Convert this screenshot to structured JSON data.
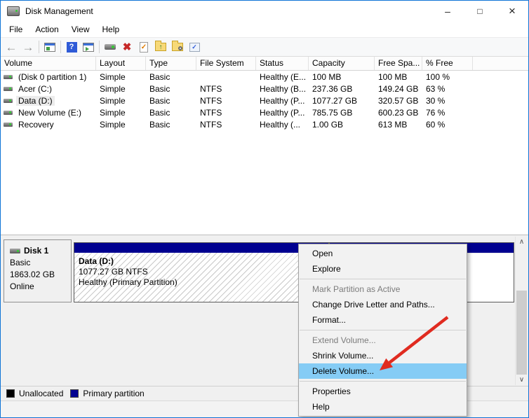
{
  "window": {
    "title": "Disk Management",
    "controls": {
      "minimize": "–",
      "maximize": "□",
      "close": "×"
    }
  },
  "menu_bar": [
    "File",
    "Action",
    "View",
    "Help"
  ],
  "toolbar": {
    "icons": [
      {
        "name": "back",
        "glyph": "←"
      },
      {
        "name": "forward",
        "glyph": "→"
      },
      {
        "name": "console-tree",
        "glyph": ""
      },
      {
        "name": "help",
        "glyph": "?"
      },
      {
        "name": "action-pane",
        "glyph": ""
      },
      {
        "name": "device",
        "glyph": ""
      },
      {
        "name": "delete",
        "glyph": "✖"
      },
      {
        "name": "check-document",
        "glyph": "✓"
      },
      {
        "name": "folder-up",
        "glyph": "↑"
      },
      {
        "name": "folder-search",
        "glyph": ""
      },
      {
        "name": "properties-list",
        "glyph": "✓"
      }
    ]
  },
  "volume_table": {
    "columns": [
      "Volume",
      "Layout",
      "Type",
      "File System",
      "Status",
      "Capacity",
      "Free Spa...",
      "% Free"
    ],
    "rows": [
      {
        "volume": "(Disk 0 partition 1)",
        "layout": "Simple",
        "type": "Basic",
        "fs": "",
        "status": "Healthy (E...",
        "capacity": "100 MB",
        "free": "100 MB",
        "pct": "100 %"
      },
      {
        "volume": "Acer (C:)",
        "layout": "Simple",
        "type": "Basic",
        "fs": "NTFS",
        "status": "Healthy (B...",
        "capacity": "237.36 GB",
        "free": "149.24 GB",
        "pct": "63 %"
      },
      {
        "volume": "Data (D:)",
        "layout": "Simple",
        "type": "Basic",
        "fs": "NTFS",
        "status": "Healthy (P...",
        "capacity": "1077.27 GB",
        "free": "320.57 GB",
        "pct": "30 %"
      },
      {
        "volume": "New Volume (E:)",
        "layout": "Simple",
        "type": "Basic",
        "fs": "NTFS",
        "status": "Healthy (P...",
        "capacity": "785.75 GB",
        "free": "600.23 GB",
        "pct": "76 %"
      },
      {
        "volume": "Recovery",
        "layout": "Simple",
        "type": "Basic",
        "fs": "NTFS",
        "status": "Healthy (...",
        "capacity": "1.00 GB",
        "free": "613 MB",
        "pct": "60 %"
      }
    ]
  },
  "disk_panel": {
    "name": "Disk 1",
    "type": "Basic",
    "size": "1863.02 GB",
    "status": "Online"
  },
  "graph_partition": {
    "label": "Data  (D:)",
    "size_fs": "1077.27 GB NTFS",
    "status": "Healthy (Primary Partition)"
  },
  "scrollbar": {
    "up": "∧",
    "down": "∨"
  },
  "context_menu": {
    "items": [
      {
        "label": "Open",
        "disabled": false,
        "highlighted": false
      },
      {
        "label": "Explore",
        "disabled": false,
        "highlighted": false
      },
      {
        "label": "Mark Partition as Active",
        "disabled": true,
        "highlighted": false
      },
      {
        "label": "Change Drive Letter and Paths...",
        "disabled": false,
        "highlighted": false
      },
      {
        "label": "Format...",
        "disabled": false,
        "highlighted": false
      },
      {
        "label": "Extend Volume...",
        "disabled": true,
        "highlighted": false
      },
      {
        "label": "Shrink Volume...",
        "disabled": false,
        "highlighted": false
      },
      {
        "label": "Delete Volume...",
        "disabled": false,
        "highlighted": true
      },
      {
        "label": "Properties",
        "disabled": false,
        "highlighted": false
      },
      {
        "label": "Help",
        "disabled": false,
        "highlighted": false
      }
    ]
  },
  "legend": {
    "items": [
      {
        "label": "Unallocated",
        "color": "#000000"
      },
      {
        "label": "Primary partition",
        "color": "#000090"
      }
    ]
  },
  "colors": {
    "window_border": "#0f74d6",
    "partition_band": "#000090",
    "menu_highlight": "#85ccf5",
    "annotation_arrow": "#e02b20"
  }
}
